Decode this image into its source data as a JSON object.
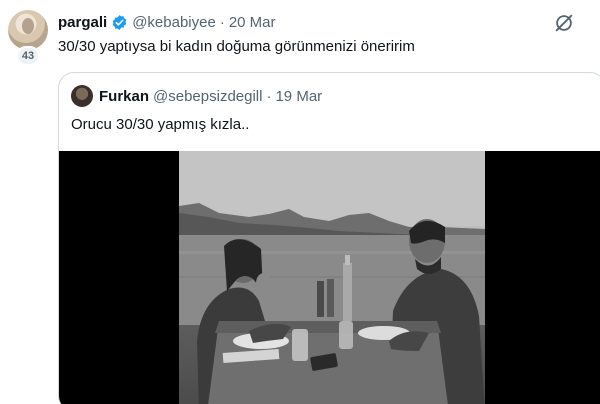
{
  "tweet": {
    "display_name": "pargali",
    "handle": "@kebabiyee",
    "separator": "·",
    "date": "20 Mar",
    "avatar_badge": "43",
    "text": "30/30 yaptıysa bi kadın doğuma görünmenizi öneririm",
    "icons": [
      "verified-badge-icon",
      "mute-icon"
    ]
  },
  "quote": {
    "display_name": "Furkan",
    "handle": "@sebepsizdegill",
    "separator": "·",
    "date": "19 Mar",
    "text": "Orucu 30/30 yapmış kızla.."
  },
  "colors": {
    "text_primary": "#0f1419",
    "text_secondary": "#536471",
    "verified_blue": "#1d9bf0",
    "border": "#cfd9de"
  }
}
